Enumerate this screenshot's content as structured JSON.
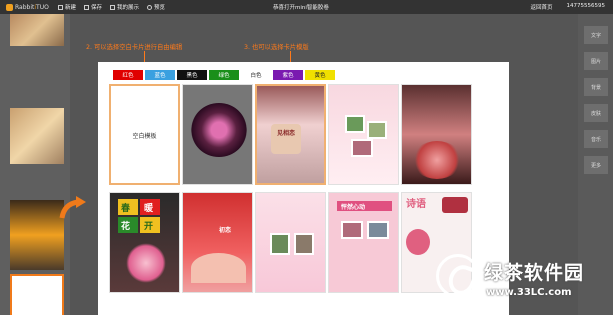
{
  "topbar": {
    "logo": "Rabbit",
    "logo_accent": "i",
    "logo_rest": "TUO",
    "items": [
      {
        "label": "新建"
      },
      {
        "label": "保存"
      },
      {
        "label": "我的展示"
      },
      {
        "label": "预览"
      }
    ],
    "title": "恭喜打开mini智能胶卷",
    "right": [
      "返回首页",
      "14775556595"
    ]
  },
  "annotations": {
    "a2": "2. 可以选择空白卡片进行自由编辑",
    "a3": "3. 也可以选择卡片模版"
  },
  "modal": {
    "colors": [
      {
        "label": "红色",
        "bg": "#e00000",
        "fg": "#ffffff"
      },
      {
        "label": "蓝色",
        "bg": "#3aa0e0",
        "fg": "#ffffff"
      },
      {
        "label": "黑色",
        "bg": "#111111",
        "fg": "#ffffff"
      },
      {
        "label": "绿色",
        "bg": "#1a8f1a",
        "fg": "#ffffff"
      },
      {
        "label": "白色",
        "bg": "#ffffff",
        "fg": "#222222"
      },
      {
        "label": "紫色",
        "bg": "#7a1ab0",
        "fg": "#ffffff"
      },
      {
        "label": "黄色",
        "bg": "#f0e000",
        "fg": "#222222"
      }
    ],
    "blank_card": "空白模板",
    "card_texts": {
      "xiang": "见相恋",
      "chun": "春",
      "nuan": "暖",
      "hua": "花",
      "kai": "开",
      "chudong": "初恋",
      "pengran": "怦然心动",
      "shiyan": "诗语"
    }
  },
  "right_toolbar": [
    "文字",
    "图片",
    "背景",
    "皮肤",
    "音乐",
    "更多"
  ],
  "watermark": {
    "name": "绿茶软件园",
    "url": "www.33LC.com"
  }
}
